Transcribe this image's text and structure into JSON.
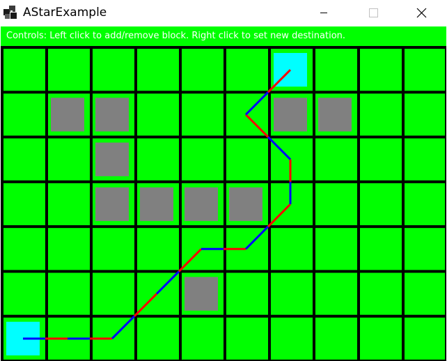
{
  "window": {
    "title": "AStarExample",
    "icons": {
      "app": "app-logo-icon",
      "minimize": "minimize-icon",
      "maximize": "maximize-icon",
      "close": "close-icon"
    }
  },
  "controls_text": "Controls: Left click to add/remove block. Right click to set new destination.",
  "grid": {
    "columns": 10,
    "rows": 7,
    "colors": {
      "background": "#00ff00",
      "lines": "#000000",
      "block": "#808080",
      "endpoint": "#00ffff",
      "path_a": "#0000ff",
      "path_b": "#ff0000"
    },
    "blocks": [
      [
        1,
        1
      ],
      [
        2,
        1
      ],
      [
        6,
        1
      ],
      [
        7,
        1
      ],
      [
        2,
        2
      ],
      [
        2,
        3
      ],
      [
        3,
        3
      ],
      [
        4,
        3
      ],
      [
        5,
        3
      ],
      [
        4,
        5
      ]
    ],
    "start": [
      0,
      6
    ],
    "destination": [
      6,
      0
    ],
    "path": [
      [
        0,
        6
      ],
      [
        1,
        6
      ],
      [
        2,
        6
      ],
      [
        3,
        5
      ],
      [
        4,
        4
      ],
      [
        5,
        4
      ],
      [
        6,
        3
      ],
      [
        6,
        2
      ],
      [
        5,
        1
      ],
      [
        6,
        0
      ]
    ]
  }
}
